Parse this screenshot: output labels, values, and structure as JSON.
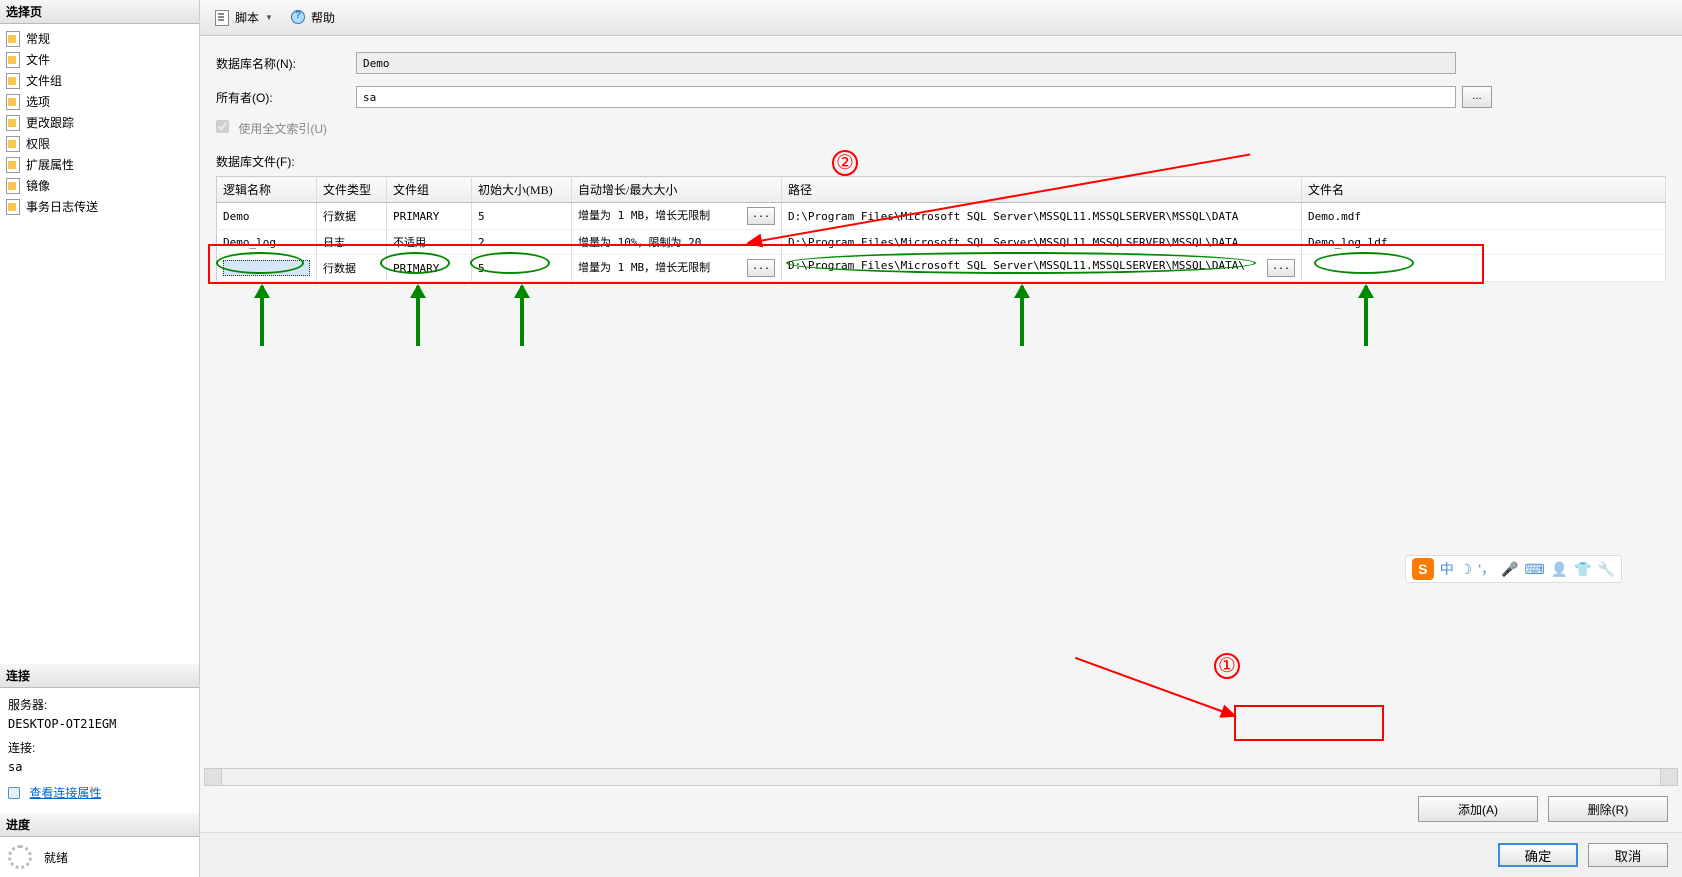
{
  "sidebar": {
    "select_header": "选择页",
    "items": [
      "常规",
      "文件",
      "文件组",
      "选项",
      "更改跟踪",
      "权限",
      "扩展属性",
      "镜像",
      "事务日志传送"
    ],
    "conn_header": "连接",
    "server_label": "服务器:",
    "server_value": "DESKTOP-OT21EGM",
    "conn_label": "连接:",
    "conn_value": "sa",
    "view_props": "查看连接属性",
    "progress_header": "进度",
    "progress_status": "就绪"
  },
  "toolbar": {
    "script": "脚本",
    "help": "帮助"
  },
  "form": {
    "dbname_label": "数据库名称(N):",
    "dbname_value": "Demo",
    "owner_label": "所有者(O):",
    "owner_value": "sa",
    "fulltext_label": "使用全文索引(U)",
    "files_label": "数据库文件(F):"
  },
  "grid": {
    "cols": [
      "逻辑名称",
      "文件类型",
      "文件组",
      "初始大小(MB)",
      "自动增长/最大大小",
      "路径",
      "文件名"
    ],
    "rows": [
      {
        "name": "Demo",
        "type": "行数据",
        "group": "PRIMARY",
        "size": "5",
        "growth": "增量为 1 MB，增长无限制",
        "path": "D:\\Program Files\\Microsoft SQL Server\\MSSQL11.MSSQLSERVER\\MSSQL\\DATA",
        "file": "Demo.mdf"
      },
      {
        "name": "Demo_log",
        "type": "日志",
        "group": "不适用",
        "size": "2",
        "growth": "增量为 10%，限制为 20...",
        "path": "D:\\Program Files\\Microsoft SQL Server\\MSSQL11.MSSQLSERVER\\MSSQL\\DATA",
        "file": "Demo_log.ldf"
      },
      {
        "name": "",
        "type": "行数据",
        "group": "PRIMARY",
        "size": "5",
        "growth": "增量为 1 MB，增长无限制",
        "path": "D:\\Program Files\\Microsoft SQL Server\\MSSQL11.MSSQLSERVER\\MSSQL\\DATA\\",
        "file": ""
      }
    ],
    "ellipsis": "..."
  },
  "buttons": {
    "add": "添加(A)",
    "delete": "删除(R)",
    "ok": "确定",
    "cancel": "取消"
  },
  "anno": {
    "one": "①",
    "two": "②"
  },
  "ime": {
    "s": "S",
    "zh": "中",
    "moon": "☽",
    "comma": "'，",
    "mic": "🎤",
    "kb": "⌨",
    "user": "👤",
    "shirt": "👕",
    "wrench": "🔧"
  }
}
